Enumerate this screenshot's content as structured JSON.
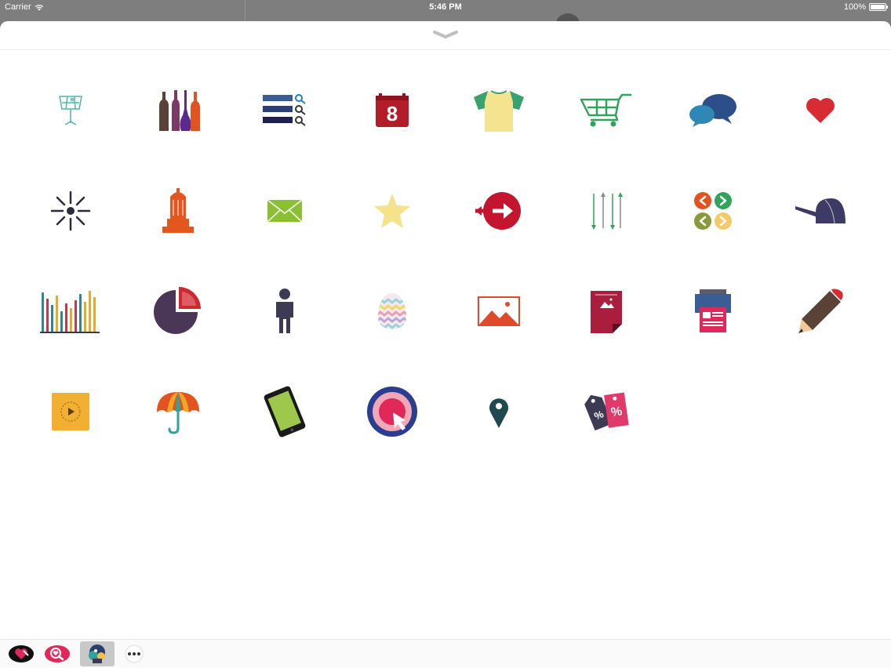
{
  "status_bar": {
    "carrier": "Carrier",
    "time": "5:46 PM",
    "battery": "100%",
    "battery_level": 1.0
  },
  "sheet": {
    "grabber_icon": "chevron-down-icon"
  },
  "stickers": [
    {
      "name": "music-stand-icon",
      "label": ""
    },
    {
      "name": "bottles-icon",
      "label": ""
    },
    {
      "name": "search-list-icon",
      "label": ""
    },
    {
      "name": "calendar-icon",
      "label": "8"
    },
    {
      "name": "tshirt-icon",
      "label": ""
    },
    {
      "name": "shopping-cart-icon",
      "label": ""
    },
    {
      "name": "chat-bubbles-icon",
      "label": ""
    },
    {
      "name": "heart-icon",
      "label": ""
    },
    {
      "name": "sparkle-icon",
      "label": ""
    },
    {
      "name": "monument-icon",
      "label": ""
    },
    {
      "name": "envelope-icon",
      "label": ""
    },
    {
      "name": "star-icon",
      "label": ""
    },
    {
      "name": "exit-arrow-icon",
      "label": ""
    },
    {
      "name": "sort-arrows-icon",
      "label": ""
    },
    {
      "name": "navigation-arrows-icon",
      "label": ""
    },
    {
      "name": "cap-icon",
      "label": ""
    },
    {
      "name": "bar-chart-icon",
      "label": ""
    },
    {
      "name": "pie-chart-icon",
      "label": ""
    },
    {
      "name": "person-icon",
      "label": ""
    },
    {
      "name": "easter-egg-icon",
      "label": ""
    },
    {
      "name": "landscape-image-icon",
      "label": ""
    },
    {
      "name": "photo-document-icon",
      "label": ""
    },
    {
      "name": "printer-icon",
      "label": ""
    },
    {
      "name": "pencil-icon",
      "label": ""
    },
    {
      "name": "video-play-icon",
      "label": ""
    },
    {
      "name": "umbrella-icon",
      "label": ""
    },
    {
      "name": "tablet-icon",
      "label": ""
    },
    {
      "name": "target-click-icon",
      "label": ""
    },
    {
      "name": "location-pin-icon",
      "label": ""
    },
    {
      "name": "discount-tags-icon",
      "label": "%"
    }
  ],
  "app_drawer": [
    {
      "name": "heart-sticker-app-icon",
      "selected": false
    },
    {
      "name": "search-heart-app-icon",
      "selected": false
    },
    {
      "name": "sticker-pack-app-icon",
      "selected": true
    },
    {
      "name": "more-apps-icon",
      "selected": false
    }
  ]
}
